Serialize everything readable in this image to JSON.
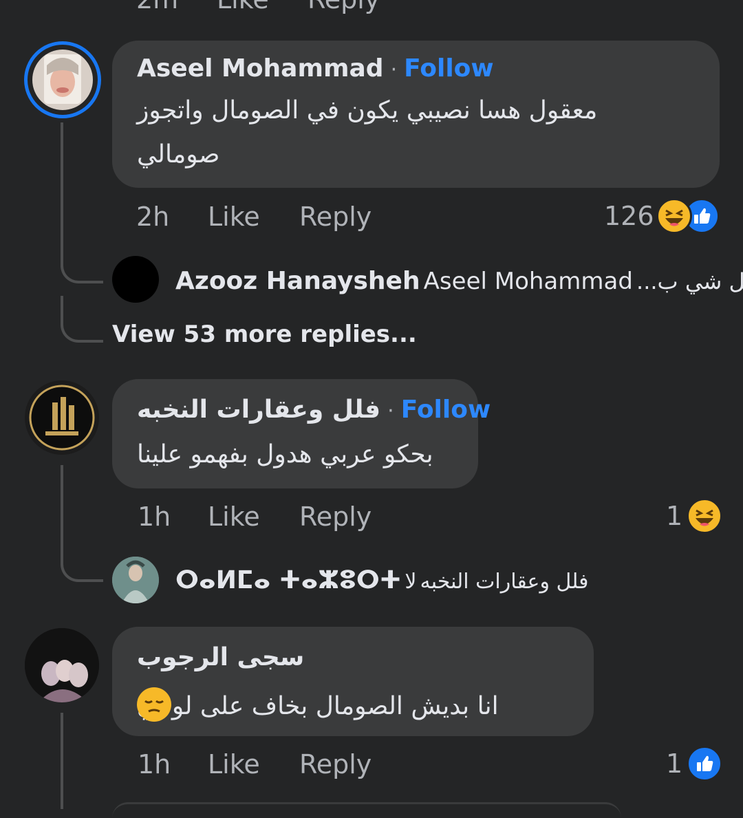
{
  "top_partial": {
    "time": "2m",
    "like": "Like",
    "reply": "Reply"
  },
  "comments": [
    {
      "author": "Aseel Mohammad",
      "follow": "Follow",
      "text_line1": "معقول هسا نصيبي يكون في الصومال واتجوز",
      "text_line2": "صومالي",
      "time": "2h",
      "like": "Like",
      "reply": "Reply",
      "reaction_count": "126",
      "reactions": [
        "haha-emoji-icon",
        "like-thumb-icon"
      ],
      "reply_preview": {
        "author": "Azooz Hanaysheh",
        "mention": "Aseel Mohammad",
        "text": "كل شي ب..."
      },
      "view_more": "View 53 more replies..."
    },
    {
      "author": "فلل وعقارات النخبه",
      "follow": "Follow",
      "text_line1": "بحكو عربي هدول بفهمو علينا",
      "time": "1h",
      "like": "Like",
      "reply": "Reply",
      "reaction_count": "1",
      "reactions": [
        "haha-emoji-icon"
      ],
      "reply_preview": {
        "author": "ⵔⴰⵍⵎⴰ ⵜⴰⵣⵓⵔⵜ",
        "mention": "فلل وعقارات النخبه",
        "text": "لا"
      }
    },
    {
      "author": "سجى الرجوب",
      "text_line1": "انا بديش الصومال بخاف على لونيي",
      "emoji": "pensive-face-icon",
      "time": "1h",
      "like": "Like",
      "reply": "Reply",
      "reaction_count": "1",
      "reactions": [
        "like-thumb-icon"
      ]
    }
  ],
  "colors": {
    "background": "#242526",
    "bubble": "#3a3b3c",
    "accent": "#2d88ff",
    "muted": "#b0b3b8"
  }
}
